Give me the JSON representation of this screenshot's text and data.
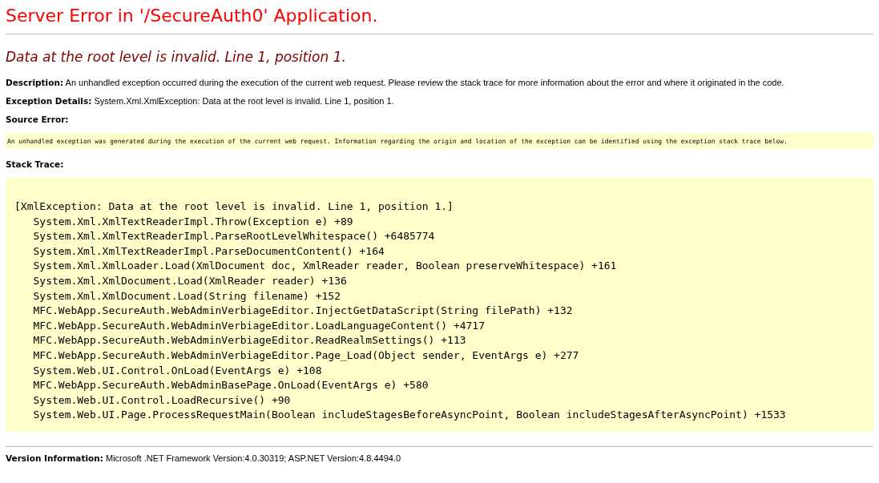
{
  "title": "Server Error in '/SecureAuth0' Application.",
  "error_heading": "Data at the root level is invalid. Line 1, position 1.",
  "description": "**Description:** An unhandled exception occurred during the execution of the current web request. Please review the stack trace for more information about the error and where it originated in the code.",
  "exception_details": "**Exception Details:** System.Xml.XmlException: Data at the root level is invalid. Line 1, position 1.",
  "source_error": {
    "heading": "Source Error:",
    "message": "An unhandled exception was generated during the execution of the current web request. Information regarding the origin and location of the exception can be identified using the exception stack trace below."
  },
  "stack_trace": {
    "heading": "Stack Trace:",
    "exception": "[XmlException: Data at the root level is invalid. Line 1, position 1.]",
    "frames": [
      "System.Xml.XmlTextReaderImpl.Throw(Exception e) +89",
      "System.Xml.XmlTextReaderImpl.ParseRootLevelWhitespace() +6485774",
      "System.Xml.XmlTextReaderImpl.ParseDocumentContent() +164",
      "System.Xml.XmlLoader.Load(XmlDocument doc, XmlReader reader, Boolean preserveWhitespace) +161",
      "System.Xml.XmlDocument.Load(XmlReader reader) +136",
      "System.Xml.XmlDocument.Load(String filename) +152",
      "MFC.WebApp.SecureAuth.WebAdminVerbiageEditor.InjectGetDataScript(String filePath) +132",
      "MFC.WebApp.SecureAuth.WebAdminVerbiageEditor.LoadLanguageContent() +4717",
      "MFC.WebApp.SecureAuth.WebAdminVerbiageEditor.ReadRealmSettings() +113",
      "MFC.WebApp.SecureAuth.WebAdminVerbiageEditor.Page_Load(Object sender, EventArgs e) +277",
      "System.Web.UI.Control.OnLoad(EventArgs e) +108",
      "MFC.WebApp.SecureAuth.WebAdminBasePage.OnLoad(EventArgs e) +580",
      "System.Web.UI.Control.LoadRecursive() +90",
      "System.Web.UI.Page.ProcessRequestMain(Boolean includeStagesBeforeAsyncPoint, Boolean includeStagesAfterAsyncPoint) +1533"
    ]
  },
  "version_information": "**Version Information:** Microsoft .NET Framework Version:4.0.30319; ASP.NET Version:4.8.4494.0"
}
